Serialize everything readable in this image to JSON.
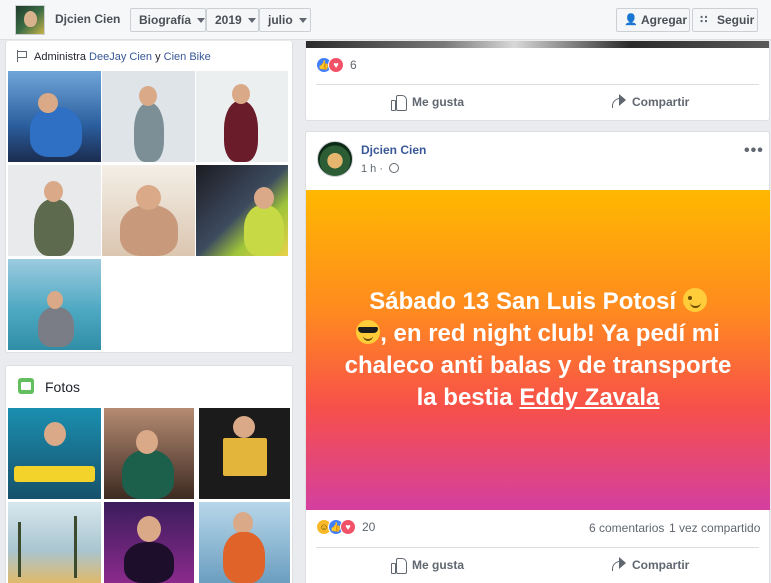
{
  "topbar": {
    "page_name": "Djcien Cien",
    "section": "Biografía",
    "year": "2019",
    "month": "julio",
    "add_label": "Agregar",
    "follow_label": "Seguir"
  },
  "admin": {
    "prefix": "Administra",
    "link1": "DeeJay Cien",
    "joiner": "y",
    "link2": "Cien Bike"
  },
  "photos_section": {
    "title": "Fotos"
  },
  "previous_post": {
    "reaction_count": "6",
    "like_label": "Me gusta",
    "share_label": "Compartir"
  },
  "post": {
    "author": "Djcien Cien",
    "time": "1 h ·",
    "more_label": "•••",
    "text_part1": "Sábado 13 San Luis Potosí",
    "text_part2": ", en red night club! Ya pedí mi chaleco anti balas y de transporte la bestia",
    "mention": "Eddy Zavala",
    "reaction_count": "20",
    "comments": "6 comentarios",
    "shares": "1 vez compartido",
    "like_label": "Me gusta",
    "share_label": "Compartir"
  },
  "icons": [
    "add-person-icon",
    "rss-icon",
    "flag-icon",
    "photos-icon",
    "like-icon",
    "share-icon",
    "globe-icon",
    "wink-emoji",
    "sunglasses-emoji"
  ],
  "colors": {
    "link": "#385898",
    "banner_top": "#ffb800",
    "banner_bottom": "#d43fa0",
    "like_blue": "#4080ff",
    "love_red": "#f25268"
  }
}
